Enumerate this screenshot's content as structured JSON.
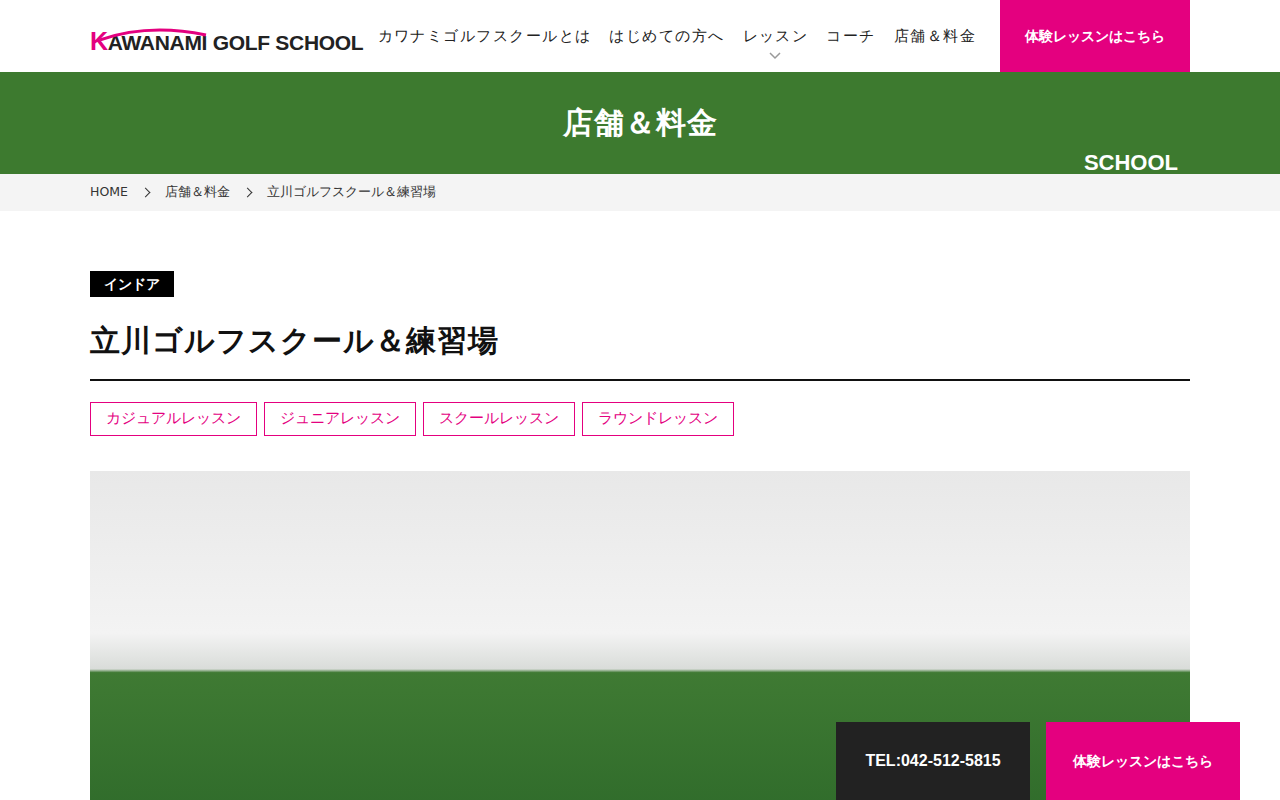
{
  "header": {
    "logo": {
      "initial": "K",
      "rest": "AWANAMI GOLF SCHOOL"
    },
    "nav": [
      {
        "label": "カワナミゴルフスクールとは",
        "dropdown": false
      },
      {
        "label": "はじめての方へ",
        "dropdown": false
      },
      {
        "label": "レッスン",
        "dropdown": true
      },
      {
        "label": "コーチ",
        "dropdown": false
      },
      {
        "label": "店舗＆料金",
        "dropdown": false
      }
    ],
    "cta": "体験レッスンはこちら"
  },
  "hero": {
    "title": "店舗＆料金",
    "label": "SCHOOL"
  },
  "breadcrumb": [
    "HOME",
    "店舗＆料金",
    "立川ゴルフスクール＆練習場"
  ],
  "store": {
    "category": "インドア",
    "title": "立川ゴルフスクール＆練習場",
    "tags": [
      "カジュアルレッスン",
      "ジュニアレッスン",
      "スクールレッスン",
      "ラウンドレッスン"
    ]
  },
  "floating": {
    "tel": "TEL:042-512-5815",
    "cta": "体験レッスンはこちら"
  }
}
